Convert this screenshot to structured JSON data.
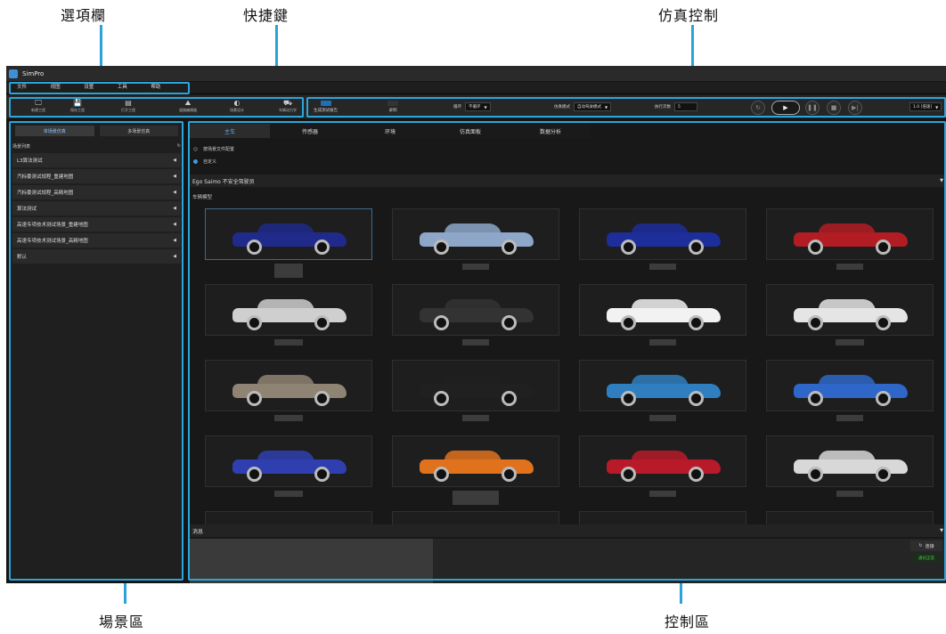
{
  "callouts": {
    "menu_bar": "選項欄",
    "shortcuts": "快捷鍵",
    "sim_control": "仿真控制",
    "scene_area": "場景區",
    "control_area": "控制區"
  },
  "app": {
    "title": "SimPro",
    "menu": [
      "文件",
      "视图",
      "设置",
      "工具",
      "帮助"
    ],
    "shortcuts": [
      {
        "icon": "🖵",
        "icon_name": "monitor-icon",
        "label": "新建工程"
      },
      {
        "icon": "💾",
        "icon_name": "save-icon",
        "label": "保存工程"
      },
      {
        "icon": "▤",
        "icon_name": "folder-icon",
        "label": "打开工程"
      },
      {
        "icon": "⛰",
        "icon_name": "road-icon",
        "label": "道路编辑器"
      },
      {
        "icon": "◐",
        "icon_name": "scene-icon",
        "label": "场景设计"
      },
      {
        "icon": "⛟",
        "icon_name": "car-icon",
        "label": "车辆动力学"
      }
    ],
    "sim_controls": {
      "generate_report": "生成测试报告",
      "record": "录制",
      "loop_label": "循环",
      "loop_value": "不循环",
      "mode_label": "仿真模式",
      "mode_value": "自动驾驶模式",
      "runs_label": "执行次数",
      "runs_value": "5",
      "speed_value": "1.0 [倍速]"
    },
    "scene_panel": {
      "tabs": [
        "单场景仿真",
        "多场景仿真"
      ],
      "list_header": "场景列表",
      "items": [
        "L3算法测试",
        "汽标委测试规程_重建地图",
        "汽标委测试规程_高精地图",
        "算法测试",
        "高速专项技术测试场景_重建地图",
        "高速专项技术测试场景_高精地图",
        "默认"
      ]
    },
    "control_panel": {
      "tabs": [
        "主车",
        "传感器",
        "环境",
        "仿真面板",
        "数据分析"
      ],
      "radio_options": [
        "按场景文件配置",
        "自定义"
      ],
      "ego_label": "Ego Saimo 不安全驾驶员",
      "vehicle_model_label": "车辆模型",
      "message_label": "消息",
      "connect_button": "连接",
      "status_text": "通讯正常"
    },
    "car_colors": [
      "#1f2a8a",
      "#8ea7c8",
      "#1d2d9a",
      "#b21d24",
      "#cfcfcf",
      "#333333",
      "#f2f2f2",
      "#e5e5e5",
      "#8f8473",
      "#202020",
      "#2f7fc0",
      "#2e67c8",
      "#2f3fb0",
      "#e0721e",
      "#b81a2a",
      "#d8d8d8"
    ]
  }
}
